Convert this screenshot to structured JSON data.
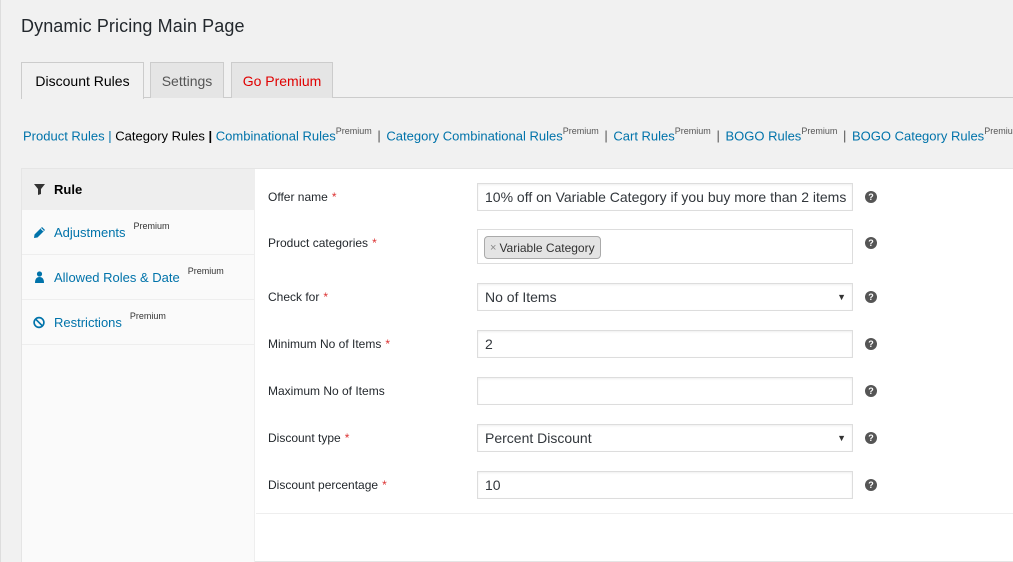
{
  "page": {
    "title": "Dynamic Pricing Main Page"
  },
  "tabs": [
    {
      "label": "Discount Rules",
      "active": true
    },
    {
      "label": "Settings"
    },
    {
      "label": "Go Premium",
      "color": "#e00000"
    }
  ],
  "sublinks": {
    "product_rules": "Product Rules",
    "category_rules": "Category Rules",
    "combinational_rules": "Combinational Rules",
    "category_combinational_rules": "Category Combinational Rules",
    "cart_rules": "Cart Rules",
    "bogo_rules": "BOGO Rules",
    "bogo_category_rules": "BOGO Category Rules",
    "premium": "Premium",
    "separator": "|"
  },
  "sidebar": {
    "items": [
      {
        "label": "Rule",
        "icon": "filter-icon",
        "active": true
      },
      {
        "label": "Adjustments",
        "icon": "pencil-icon",
        "badge": "Premium"
      },
      {
        "label": "Allowed Roles & Date",
        "icon": "user-icon",
        "badge": "Premium"
      },
      {
        "label": "Restrictions",
        "icon": "ban-icon",
        "badge": "Premium"
      }
    ]
  },
  "form": {
    "required_mark": "*",
    "offer_name": {
      "label": "Offer name",
      "value": "10% off on Variable Category if you buy more than 2 items"
    },
    "product_categories": {
      "label": "Product categories",
      "tag": "Variable Category",
      "remove": "×"
    },
    "check_for": {
      "label": "Check for",
      "value": "No of Items"
    },
    "min_items": {
      "label": "Minimum No of Items",
      "value": "2"
    },
    "max_items": {
      "label": "Maximum No of Items",
      "value": ""
    },
    "discount_type": {
      "label": "Discount type",
      "value": "Percent Discount"
    },
    "discount_percentage": {
      "label": "Discount percentage",
      "value": "10"
    },
    "help_glyph": "?"
  },
  "colors": {
    "link": "#0073aa",
    "premium": "#e00000",
    "required": "#dc3232"
  }
}
